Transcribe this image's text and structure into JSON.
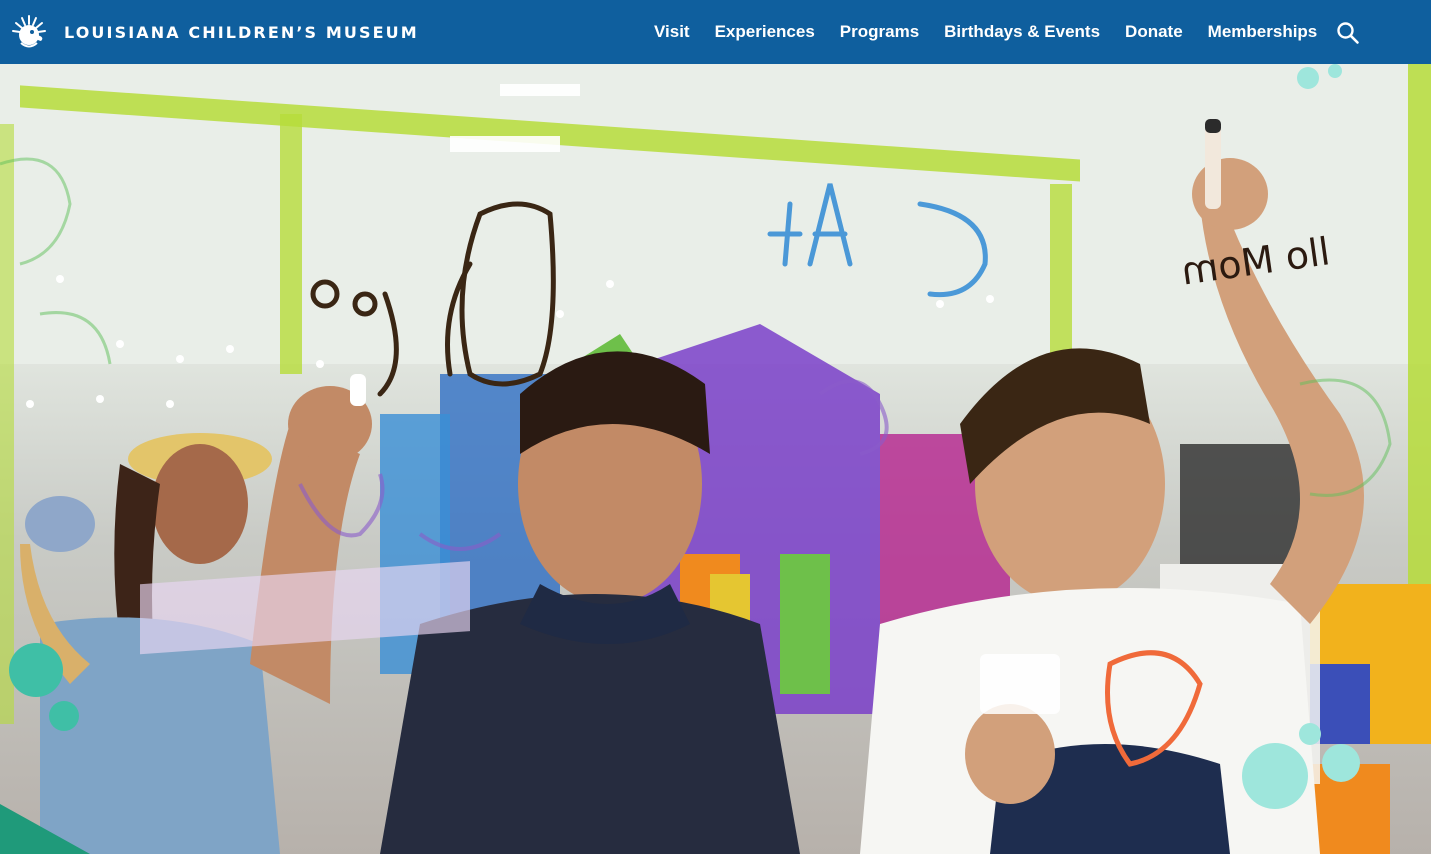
{
  "header": {
    "brand_name": "LOUISIANA CHILDREN’S MUSEUM",
    "background_color": "#0f5f9e",
    "logo_icon": "pelican-logo-icon",
    "nav_items": [
      {
        "label": "Visit"
      },
      {
        "label": "Experiences"
      },
      {
        "label": "Programs"
      },
      {
        "label": "Birthdays & Events"
      },
      {
        "label": "Donate"
      },
      {
        "label": "Memberships"
      }
    ],
    "search_icon": "search-icon"
  },
  "hero": {
    "handwriting": [
      "tAD",
      "llo Mom",
      "potato"
    ],
    "accent_colors": {
      "bubble_teal": "#3fbfa6",
      "bubble_aqua": "#9ee6dc",
      "corner_green": "#1f9a7a",
      "marker_blue": "#3a8fd6",
      "marker_purple": "#8a5cc9"
    }
  }
}
